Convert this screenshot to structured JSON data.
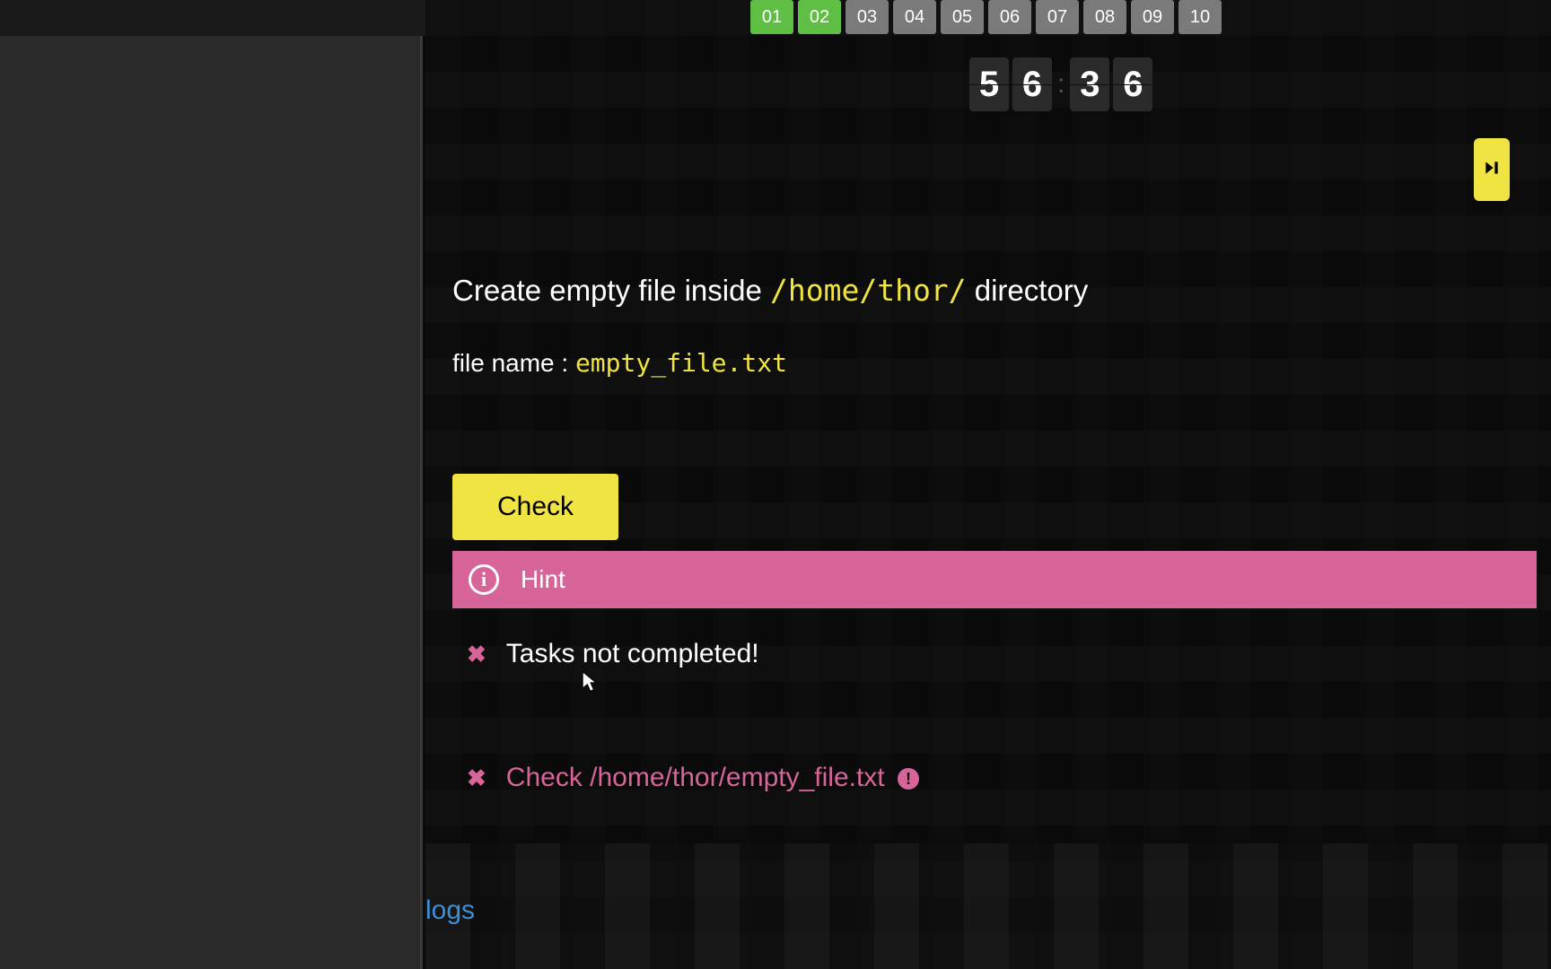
{
  "steps": {
    "items": [
      "01",
      "02",
      "03",
      "04",
      "05",
      "06",
      "07",
      "08",
      "09",
      "10"
    ],
    "completed_index": 0,
    "current_index": 1
  },
  "timer": {
    "d1": "5",
    "d2": "6",
    "d3": "3",
    "d4": "6"
  },
  "task": {
    "title_prefix": "Create empty file inside ",
    "title_path": "/home/thor/",
    "title_suffix": " directory",
    "sub_prefix": "file name : ",
    "sub_filename": "empty_file.txt"
  },
  "buttons": {
    "check": "Check"
  },
  "hint": {
    "icon_letter": "i",
    "label": "Hint"
  },
  "errors": {
    "tasks_not_completed": "Tasks not completed!",
    "check_path": "Check /home/thor/empty_file.txt"
  },
  "logs_link": "logs",
  "colors": {
    "accent_yellow": "#f0e442",
    "pink": "#d8659a",
    "green": "#5fbf45"
  }
}
